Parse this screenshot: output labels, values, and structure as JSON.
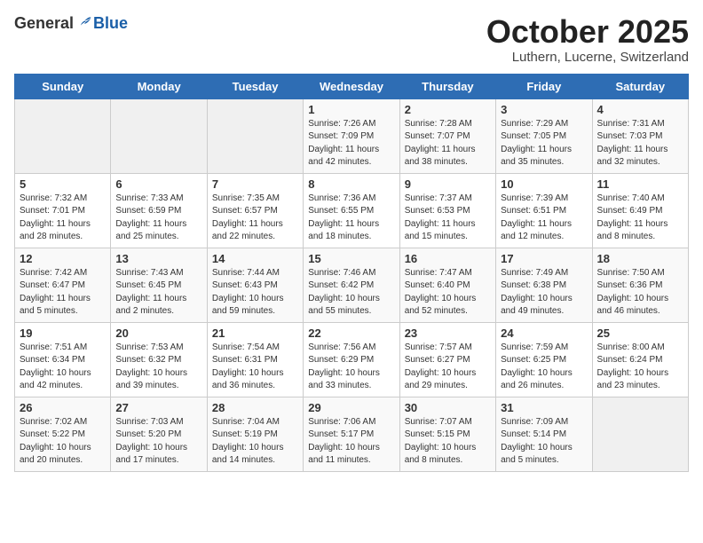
{
  "header": {
    "logo_general": "General",
    "logo_blue": "Blue",
    "month_title": "October 2025",
    "location": "Luthern, Lucerne, Switzerland"
  },
  "weekdays": [
    "Sunday",
    "Monday",
    "Tuesday",
    "Wednesday",
    "Thursday",
    "Friday",
    "Saturday"
  ],
  "weeks": [
    [
      {
        "day": "",
        "info": ""
      },
      {
        "day": "",
        "info": ""
      },
      {
        "day": "",
        "info": ""
      },
      {
        "day": "1",
        "info": "Sunrise: 7:26 AM\nSunset: 7:09 PM\nDaylight: 11 hours\nand 42 minutes."
      },
      {
        "day": "2",
        "info": "Sunrise: 7:28 AM\nSunset: 7:07 PM\nDaylight: 11 hours\nand 38 minutes."
      },
      {
        "day": "3",
        "info": "Sunrise: 7:29 AM\nSunset: 7:05 PM\nDaylight: 11 hours\nand 35 minutes."
      },
      {
        "day": "4",
        "info": "Sunrise: 7:31 AM\nSunset: 7:03 PM\nDaylight: 11 hours\nand 32 minutes."
      }
    ],
    [
      {
        "day": "5",
        "info": "Sunrise: 7:32 AM\nSunset: 7:01 PM\nDaylight: 11 hours\nand 28 minutes."
      },
      {
        "day": "6",
        "info": "Sunrise: 7:33 AM\nSunset: 6:59 PM\nDaylight: 11 hours\nand 25 minutes."
      },
      {
        "day": "7",
        "info": "Sunrise: 7:35 AM\nSunset: 6:57 PM\nDaylight: 11 hours\nand 22 minutes."
      },
      {
        "day": "8",
        "info": "Sunrise: 7:36 AM\nSunset: 6:55 PM\nDaylight: 11 hours\nand 18 minutes."
      },
      {
        "day": "9",
        "info": "Sunrise: 7:37 AM\nSunset: 6:53 PM\nDaylight: 11 hours\nand 15 minutes."
      },
      {
        "day": "10",
        "info": "Sunrise: 7:39 AM\nSunset: 6:51 PM\nDaylight: 11 hours\nand 12 minutes."
      },
      {
        "day": "11",
        "info": "Sunrise: 7:40 AM\nSunset: 6:49 PM\nDaylight: 11 hours\nand 8 minutes."
      }
    ],
    [
      {
        "day": "12",
        "info": "Sunrise: 7:42 AM\nSunset: 6:47 PM\nDaylight: 11 hours\nand 5 minutes."
      },
      {
        "day": "13",
        "info": "Sunrise: 7:43 AM\nSunset: 6:45 PM\nDaylight: 11 hours\nand 2 minutes."
      },
      {
        "day": "14",
        "info": "Sunrise: 7:44 AM\nSunset: 6:43 PM\nDaylight: 10 hours\nand 59 minutes."
      },
      {
        "day": "15",
        "info": "Sunrise: 7:46 AM\nSunset: 6:42 PM\nDaylight: 10 hours\nand 55 minutes."
      },
      {
        "day": "16",
        "info": "Sunrise: 7:47 AM\nSunset: 6:40 PM\nDaylight: 10 hours\nand 52 minutes."
      },
      {
        "day": "17",
        "info": "Sunrise: 7:49 AM\nSunset: 6:38 PM\nDaylight: 10 hours\nand 49 minutes."
      },
      {
        "day": "18",
        "info": "Sunrise: 7:50 AM\nSunset: 6:36 PM\nDaylight: 10 hours\nand 46 minutes."
      }
    ],
    [
      {
        "day": "19",
        "info": "Sunrise: 7:51 AM\nSunset: 6:34 PM\nDaylight: 10 hours\nand 42 minutes."
      },
      {
        "day": "20",
        "info": "Sunrise: 7:53 AM\nSunset: 6:32 PM\nDaylight: 10 hours\nand 39 minutes."
      },
      {
        "day": "21",
        "info": "Sunrise: 7:54 AM\nSunset: 6:31 PM\nDaylight: 10 hours\nand 36 minutes."
      },
      {
        "day": "22",
        "info": "Sunrise: 7:56 AM\nSunset: 6:29 PM\nDaylight: 10 hours\nand 33 minutes."
      },
      {
        "day": "23",
        "info": "Sunrise: 7:57 AM\nSunset: 6:27 PM\nDaylight: 10 hours\nand 29 minutes."
      },
      {
        "day": "24",
        "info": "Sunrise: 7:59 AM\nSunset: 6:25 PM\nDaylight: 10 hours\nand 26 minutes."
      },
      {
        "day": "25",
        "info": "Sunrise: 8:00 AM\nSunset: 6:24 PM\nDaylight: 10 hours\nand 23 minutes."
      }
    ],
    [
      {
        "day": "26",
        "info": "Sunrise: 7:02 AM\nSunset: 5:22 PM\nDaylight: 10 hours\nand 20 minutes."
      },
      {
        "day": "27",
        "info": "Sunrise: 7:03 AM\nSunset: 5:20 PM\nDaylight: 10 hours\nand 17 minutes."
      },
      {
        "day": "28",
        "info": "Sunrise: 7:04 AM\nSunset: 5:19 PM\nDaylight: 10 hours\nand 14 minutes."
      },
      {
        "day": "29",
        "info": "Sunrise: 7:06 AM\nSunset: 5:17 PM\nDaylight: 10 hours\nand 11 minutes."
      },
      {
        "day": "30",
        "info": "Sunrise: 7:07 AM\nSunset: 5:15 PM\nDaylight: 10 hours\nand 8 minutes."
      },
      {
        "day": "31",
        "info": "Sunrise: 7:09 AM\nSunset: 5:14 PM\nDaylight: 10 hours\nand 5 minutes."
      },
      {
        "day": "",
        "info": ""
      }
    ]
  ]
}
